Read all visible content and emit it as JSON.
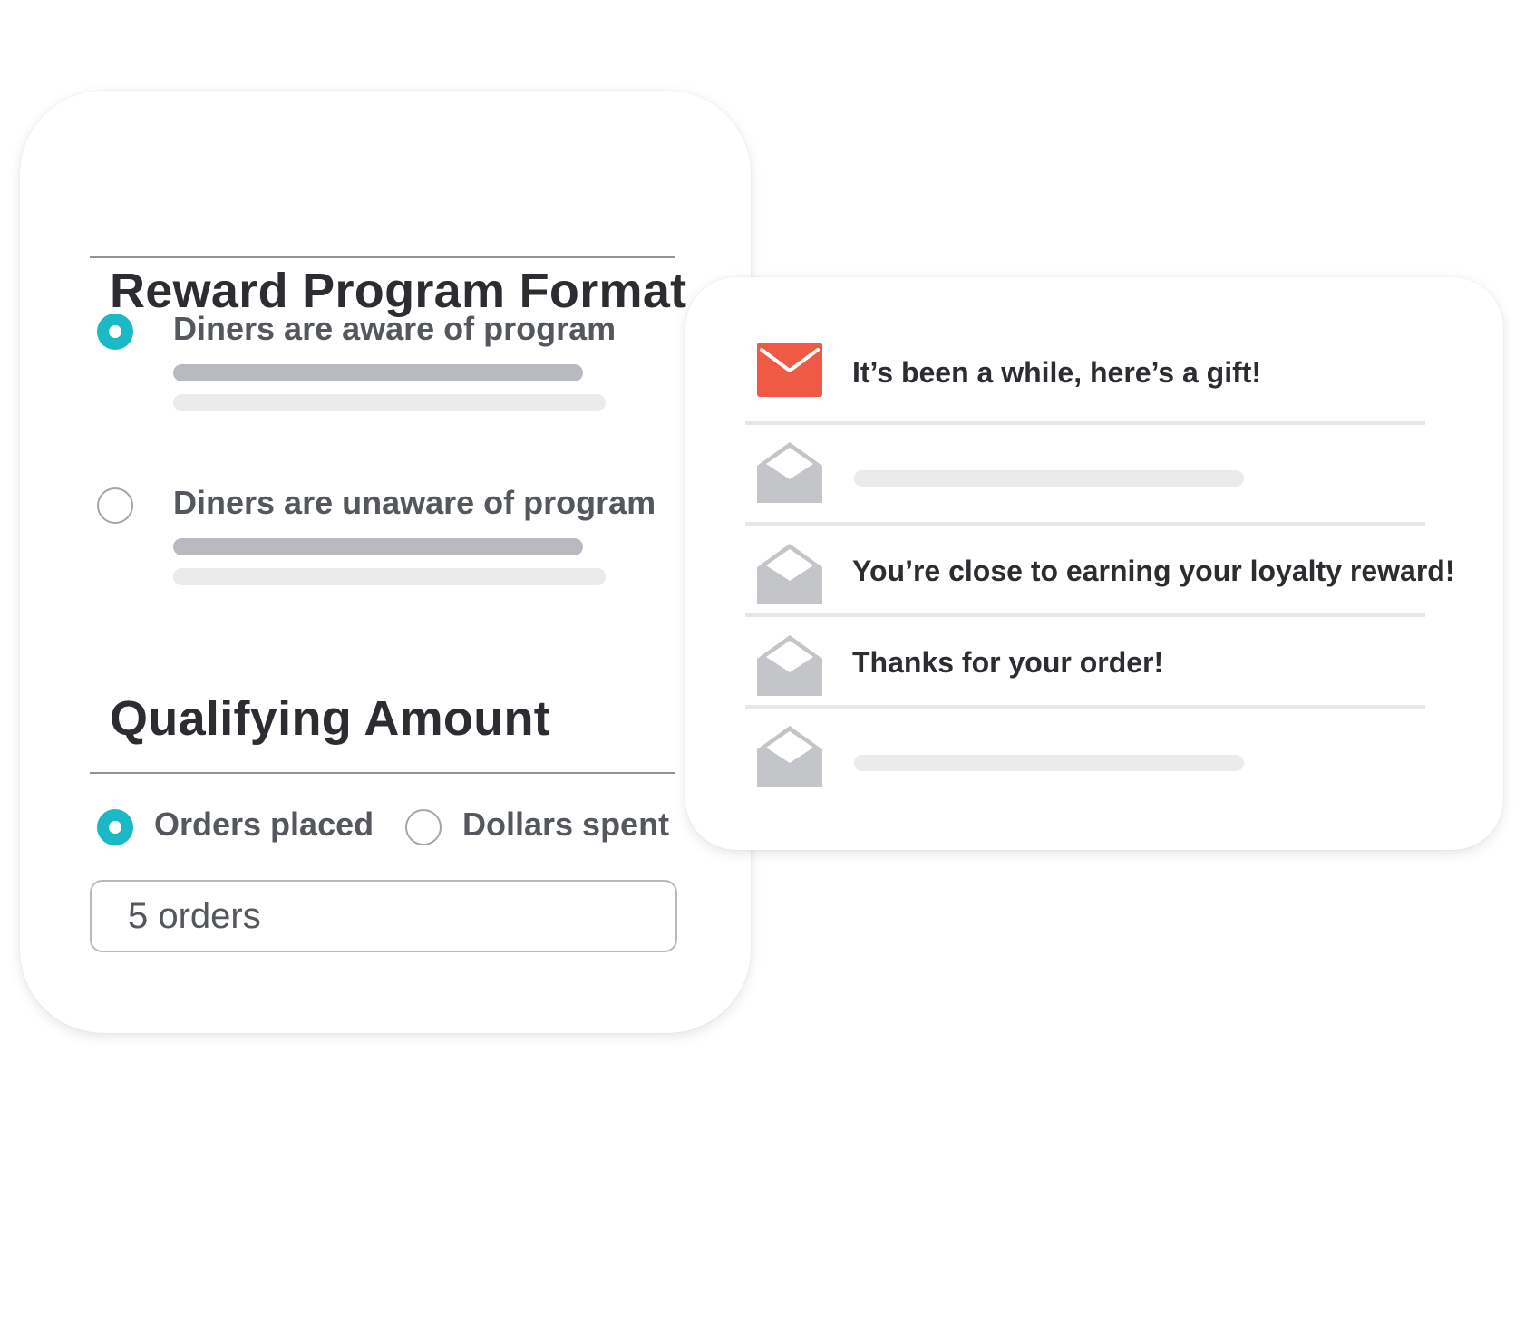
{
  "reward_program": {
    "title": "Reward Program Format",
    "options": [
      {
        "label": "Diners are aware of program",
        "selected": true
      },
      {
        "label": "Diners are unaware of program",
        "selected": false
      }
    ]
  },
  "qualifying_amount": {
    "title": "Qualifying Amount",
    "options": [
      {
        "label": "Orders placed",
        "selected": true
      },
      {
        "label": "Dollars spent",
        "selected": false
      }
    ],
    "input_value": "5 orders"
  },
  "messages": [
    {
      "text": "It’s been a while, here’s a gift!",
      "icon": "closed-envelope-icon",
      "unread": true
    },
    {
      "text": "",
      "icon": "open-envelope-icon",
      "unread": false
    },
    {
      "text": "You’re close to earning your loyalty reward!",
      "icon": "open-envelope-icon",
      "unread": false
    },
    {
      "text": "Thanks for your order!",
      "icon": "open-envelope-icon",
      "unread": false
    },
    {
      "text": "",
      "icon": "open-envelope-icon",
      "unread": false
    }
  ],
  "colors": {
    "accent": "#1bb8c6",
    "unread_envelope": "#f05a45",
    "read_envelope": "#c4c5c8",
    "heading": "#2b2d31",
    "label": "#54575c"
  }
}
